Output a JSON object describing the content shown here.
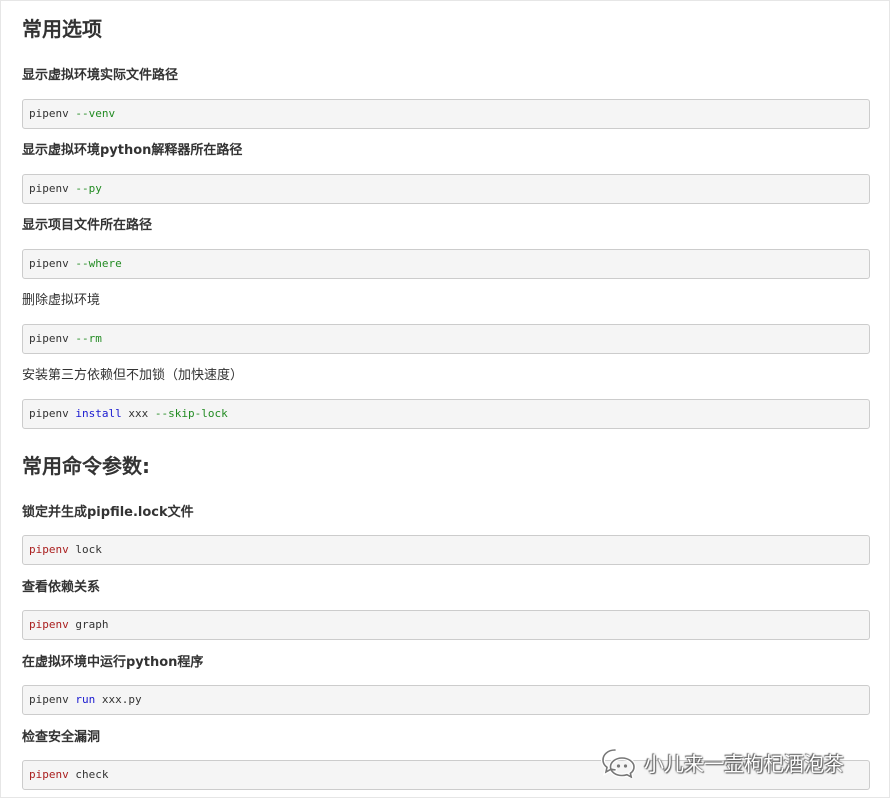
{
  "sections": [
    {
      "title": "常用选项",
      "items": [
        {
          "label": "显示虚拟环境实际文件路径",
          "code": [
            {
              "t": "pipenv ",
              "c": "plain"
            },
            {
              "t": "--venv",
              "c": "green"
            }
          ]
        },
        {
          "label": "显示虚拟环境python解释器所在路径",
          "code": [
            {
              "t": "pipenv ",
              "c": "plain"
            },
            {
              "t": "--py",
              "c": "green"
            }
          ]
        },
        {
          "label": "显示项目文件所在路径",
          "code": [
            {
              "t": "pipenv ",
              "c": "plain"
            },
            {
              "t": "--where",
              "c": "green"
            }
          ]
        },
        {
          "label": "删除虚拟环境",
          "code": [
            {
              "t": "pipenv ",
              "c": "plain"
            },
            {
              "t": "--rm",
              "c": "green"
            }
          ]
        },
        {
          "label": "安装第三方依赖但不加锁（加快速度）",
          "code": [
            {
              "t": "pipenv ",
              "c": "plain"
            },
            {
              "t": "install",
              "c": "blue"
            },
            {
              "t": " xxx ",
              "c": "plain"
            },
            {
              "t": "--skip-lock",
              "c": "green"
            }
          ]
        }
      ]
    },
    {
      "title": "常用命令参数:",
      "items": [
        {
          "label": "锁定并生成pipfile.lock文件",
          "code": [
            {
              "t": "pipenv",
              "c": "red"
            },
            {
              "t": " lock",
              "c": "plain"
            }
          ]
        },
        {
          "label": "查看依赖关系",
          "code": [
            {
              "t": "pipenv",
              "c": "red"
            },
            {
              "t": " graph",
              "c": "plain"
            }
          ]
        },
        {
          "label": "在虚拟环境中运行python程序",
          "code": [
            {
              "t": "pipenv ",
              "c": "plain"
            },
            {
              "t": "run",
              "c": "blue"
            },
            {
              "t": " xxx.py",
              "c": "plain"
            }
          ]
        },
        {
          "label": "检查安全漏洞",
          "code": [
            {
              "t": "pipenv",
              "c": "red"
            },
            {
              "t": " check",
              "c": "plain"
            }
          ]
        }
      ]
    }
  ],
  "watermark": {
    "text": "小儿来一壶枸杞酒泡茶",
    "icon": "wechat-official-account-icon"
  },
  "colors": {
    "green": "#228b22",
    "blue": "#1a1ad0",
    "red": "#aa1f1f",
    "code_bg": "#f5f5f5",
    "code_border": "#cccccc"
  }
}
